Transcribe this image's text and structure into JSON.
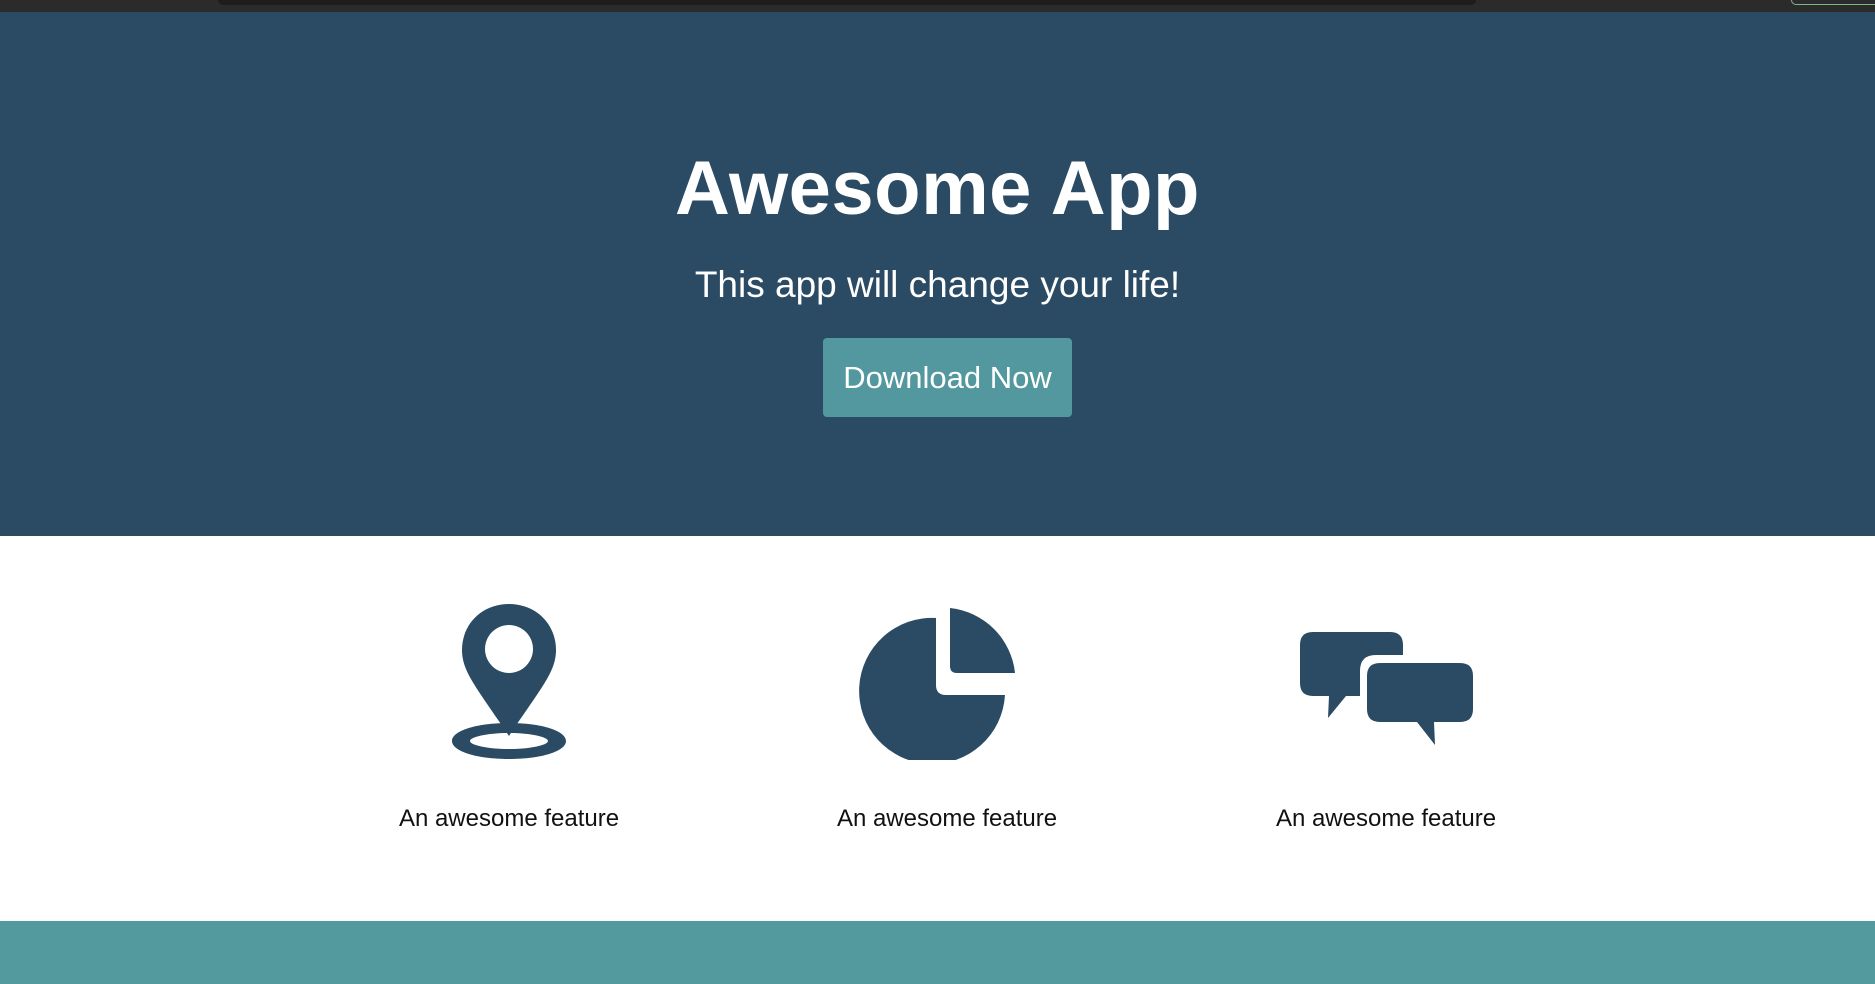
{
  "hero": {
    "title": "Awesome App",
    "tagline": "This app will change your life!",
    "cta_label": "Download Now"
  },
  "features": [
    {
      "icon": "map-marker-icon",
      "label": "An awesome feature"
    },
    {
      "icon": "pie-chart-icon",
      "label": "An awesome feature"
    },
    {
      "icon": "chat-bubbles-icon",
      "label": "An awesome feature"
    }
  ],
  "colors": {
    "hero_bg": "#2a4b63",
    "accent": "#52989e",
    "icon": "#2a4b63",
    "text_dark": "#111111"
  }
}
